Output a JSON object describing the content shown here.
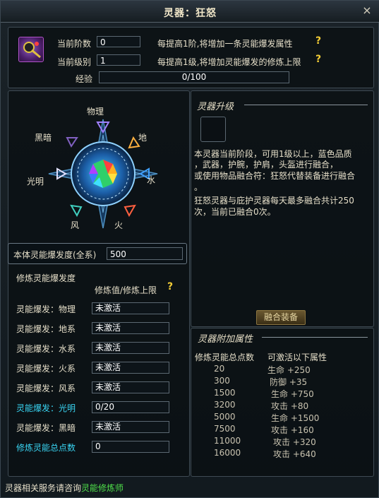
{
  "window": {
    "title": "灵器：狂怒",
    "close_glyph": "×"
  },
  "top": {
    "stage_label": "当前阶数",
    "stage_value": "0",
    "level_label": "当前级别",
    "level_value": "1",
    "stage_hint": "每提高1阶,将增加一条灵能爆发属性",
    "level_hint": "每提高1级,将增加灵能爆发的修炼上限",
    "exp_label": "经验",
    "exp_value": "0/100",
    "exp_progress": 0,
    "help": "?"
  },
  "compass": {
    "physical": "物理",
    "earth": "地",
    "water": "水",
    "fire": "火",
    "wind": "风",
    "light": "光明",
    "dark": "黑暗"
  },
  "burst": {
    "label": "本体灵能爆发度(全系)",
    "value": "500"
  },
  "training": {
    "title": "修炼灵能爆发度",
    "header": "修炼值/修炼上限",
    "help": "?",
    "rows": [
      {
        "label": "灵能爆发：物理",
        "value": "未激活"
      },
      {
        "label": "灵能爆发：地系",
        "value": "未激活"
      },
      {
        "label": "灵能爆发：水系",
        "value": "未激活"
      },
      {
        "label": "灵能爆发：火系",
        "value": "未激活"
      },
      {
        "label": "灵能爆发：风系",
        "value": "未激活"
      },
      {
        "label": "灵能爆发：光明",
        "value": "0/20"
      },
      {
        "label": "灵能爆发：黑暗",
        "value": "未激活"
      }
    ],
    "total_label": "修炼灵能总点数",
    "total_value": "0"
  },
  "upgrade": {
    "title": "灵器升级",
    "desc1": "本灵器当前阶段，可用1级以上，蓝色品质",
    "desc2": "，武器，护腕，护肩，头盔进行融合，",
    "desc3": "或使用物品融合符：狂怒代替装备进行融合",
    "desc4": "。",
    "desc5": "狂怒灵器与庇护灵器每天最多融合共计250",
    "desc6": "次，当前已融合0次。",
    "button": "融合装备"
  },
  "attrs": {
    "title": "灵器附加属性",
    "col1": "修炼灵能总点数",
    "col2": "可激活以下属性",
    "rows": [
      {
        "points": "20",
        "attr": "生命 +250"
      },
      {
        "points": "300",
        "attr": "防御 +35"
      },
      {
        "points": "1500",
        "attr": "生命 +750"
      },
      {
        "points": "3200",
        "attr": "攻击 +80"
      },
      {
        "points": "5000",
        "attr": "生命 +1500"
      },
      {
        "points": "7500",
        "attr": "攻击 +160"
      },
      {
        "points": "11000",
        "attr": "攻击 +320"
      },
      {
        "points": "16000",
        "attr": "攻击 +640"
      }
    ]
  },
  "footer": {
    "text": "灵器相关服务请咨询",
    "npc": "灵能修炼师"
  },
  "colors": {
    "accent_gold": "#f2cc36",
    "cyan": "#39d4f2",
    "green": "#4fe04a"
  }
}
